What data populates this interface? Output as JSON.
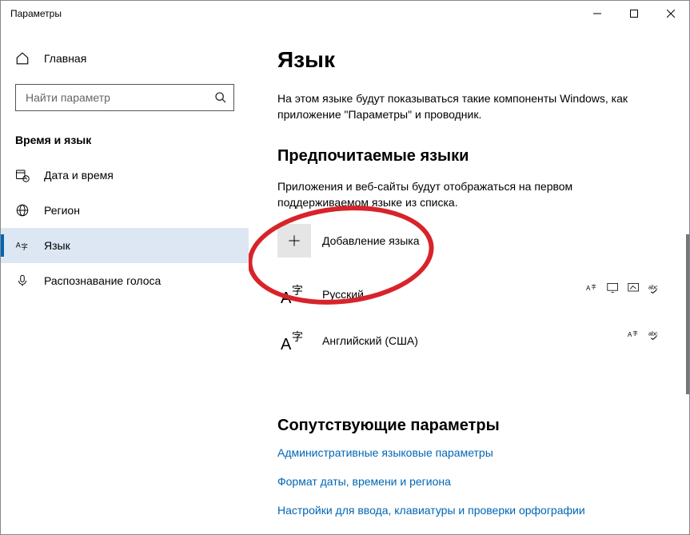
{
  "window": {
    "title": "Параметры"
  },
  "sidebar": {
    "home": "Главная",
    "search_placeholder": "Найти параметр",
    "section": "Время и язык",
    "items": [
      {
        "label": "Дата и время"
      },
      {
        "label": "Регион"
      },
      {
        "label": "Язык"
      },
      {
        "label": "Распознавание голоса"
      }
    ]
  },
  "page": {
    "title": "Язык",
    "description": "На этом языке будут показываться такие компоненты Windows, как приложение \"Параметры\" и проводник.",
    "preferred_title": "Предпочитаемые языки",
    "preferred_desc": "Приложения и веб-сайты будут отображаться на первом поддерживаемом языке из списка.",
    "add_language": "Добавление языка",
    "languages": [
      {
        "name": "Русский"
      },
      {
        "name": "Английский (США)"
      }
    ],
    "related_title": "Сопутствующие параметры",
    "links": [
      "Административные языковые параметры",
      "Формат даты, времени и региона",
      "Настройки для ввода, клавиатуры и проверки орфографии"
    ]
  }
}
